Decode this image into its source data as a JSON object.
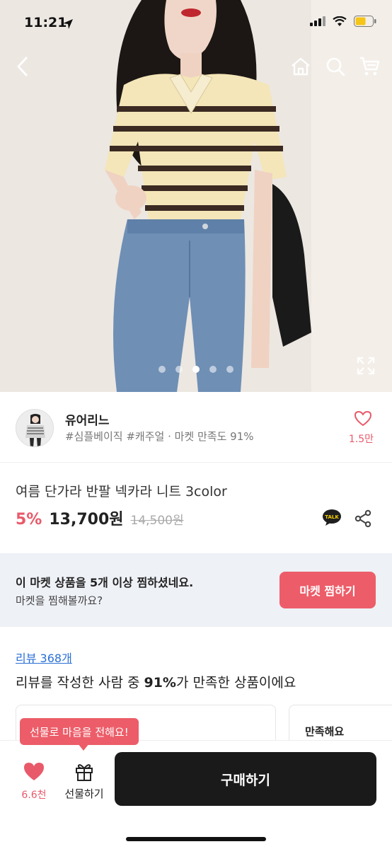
{
  "status_bar": {
    "time": "11:21"
  },
  "nav": {
    "icons": [
      "back-icon",
      "home-icon",
      "search-icon",
      "cart-icon"
    ]
  },
  "carousel": {
    "dot_count": 5,
    "active_index": 2
  },
  "seller": {
    "name": "유어리느",
    "tags": "#심플베이직 #캐주얼 · 마켓 만족도 91%",
    "favorite_count": "1.5만"
  },
  "product": {
    "title": "여름 단가라 반팔 넥카라 니트 3color",
    "discount": "5%",
    "price": "13,700원",
    "original_price": "14,500원"
  },
  "market_banner": {
    "line1": "이 마켓 상품을 5개 이상 찜하셨네요.",
    "line2": "마켓을 찜해볼까요?",
    "button_label": "마켓 찜하기"
  },
  "reviews": {
    "link_label": "리뷰 368개",
    "summary_prefix": "리뷰를 작성한 사람 중 ",
    "summary_bold": "91%",
    "summary_suffix": "가 만족한 상품이에요",
    "card2_title": "만족해요"
  },
  "bottom_bar": {
    "tooltip": "선물로 마음을 전해요!",
    "like_count": "6.6천",
    "gift_label": "선물하기",
    "buy_label": "구매하기"
  },
  "colors": {
    "accent": "#ec5d69",
    "buy_button": "#1a1a1a",
    "banner_bg": "#eef1f6",
    "link": "#2a6fd6"
  }
}
